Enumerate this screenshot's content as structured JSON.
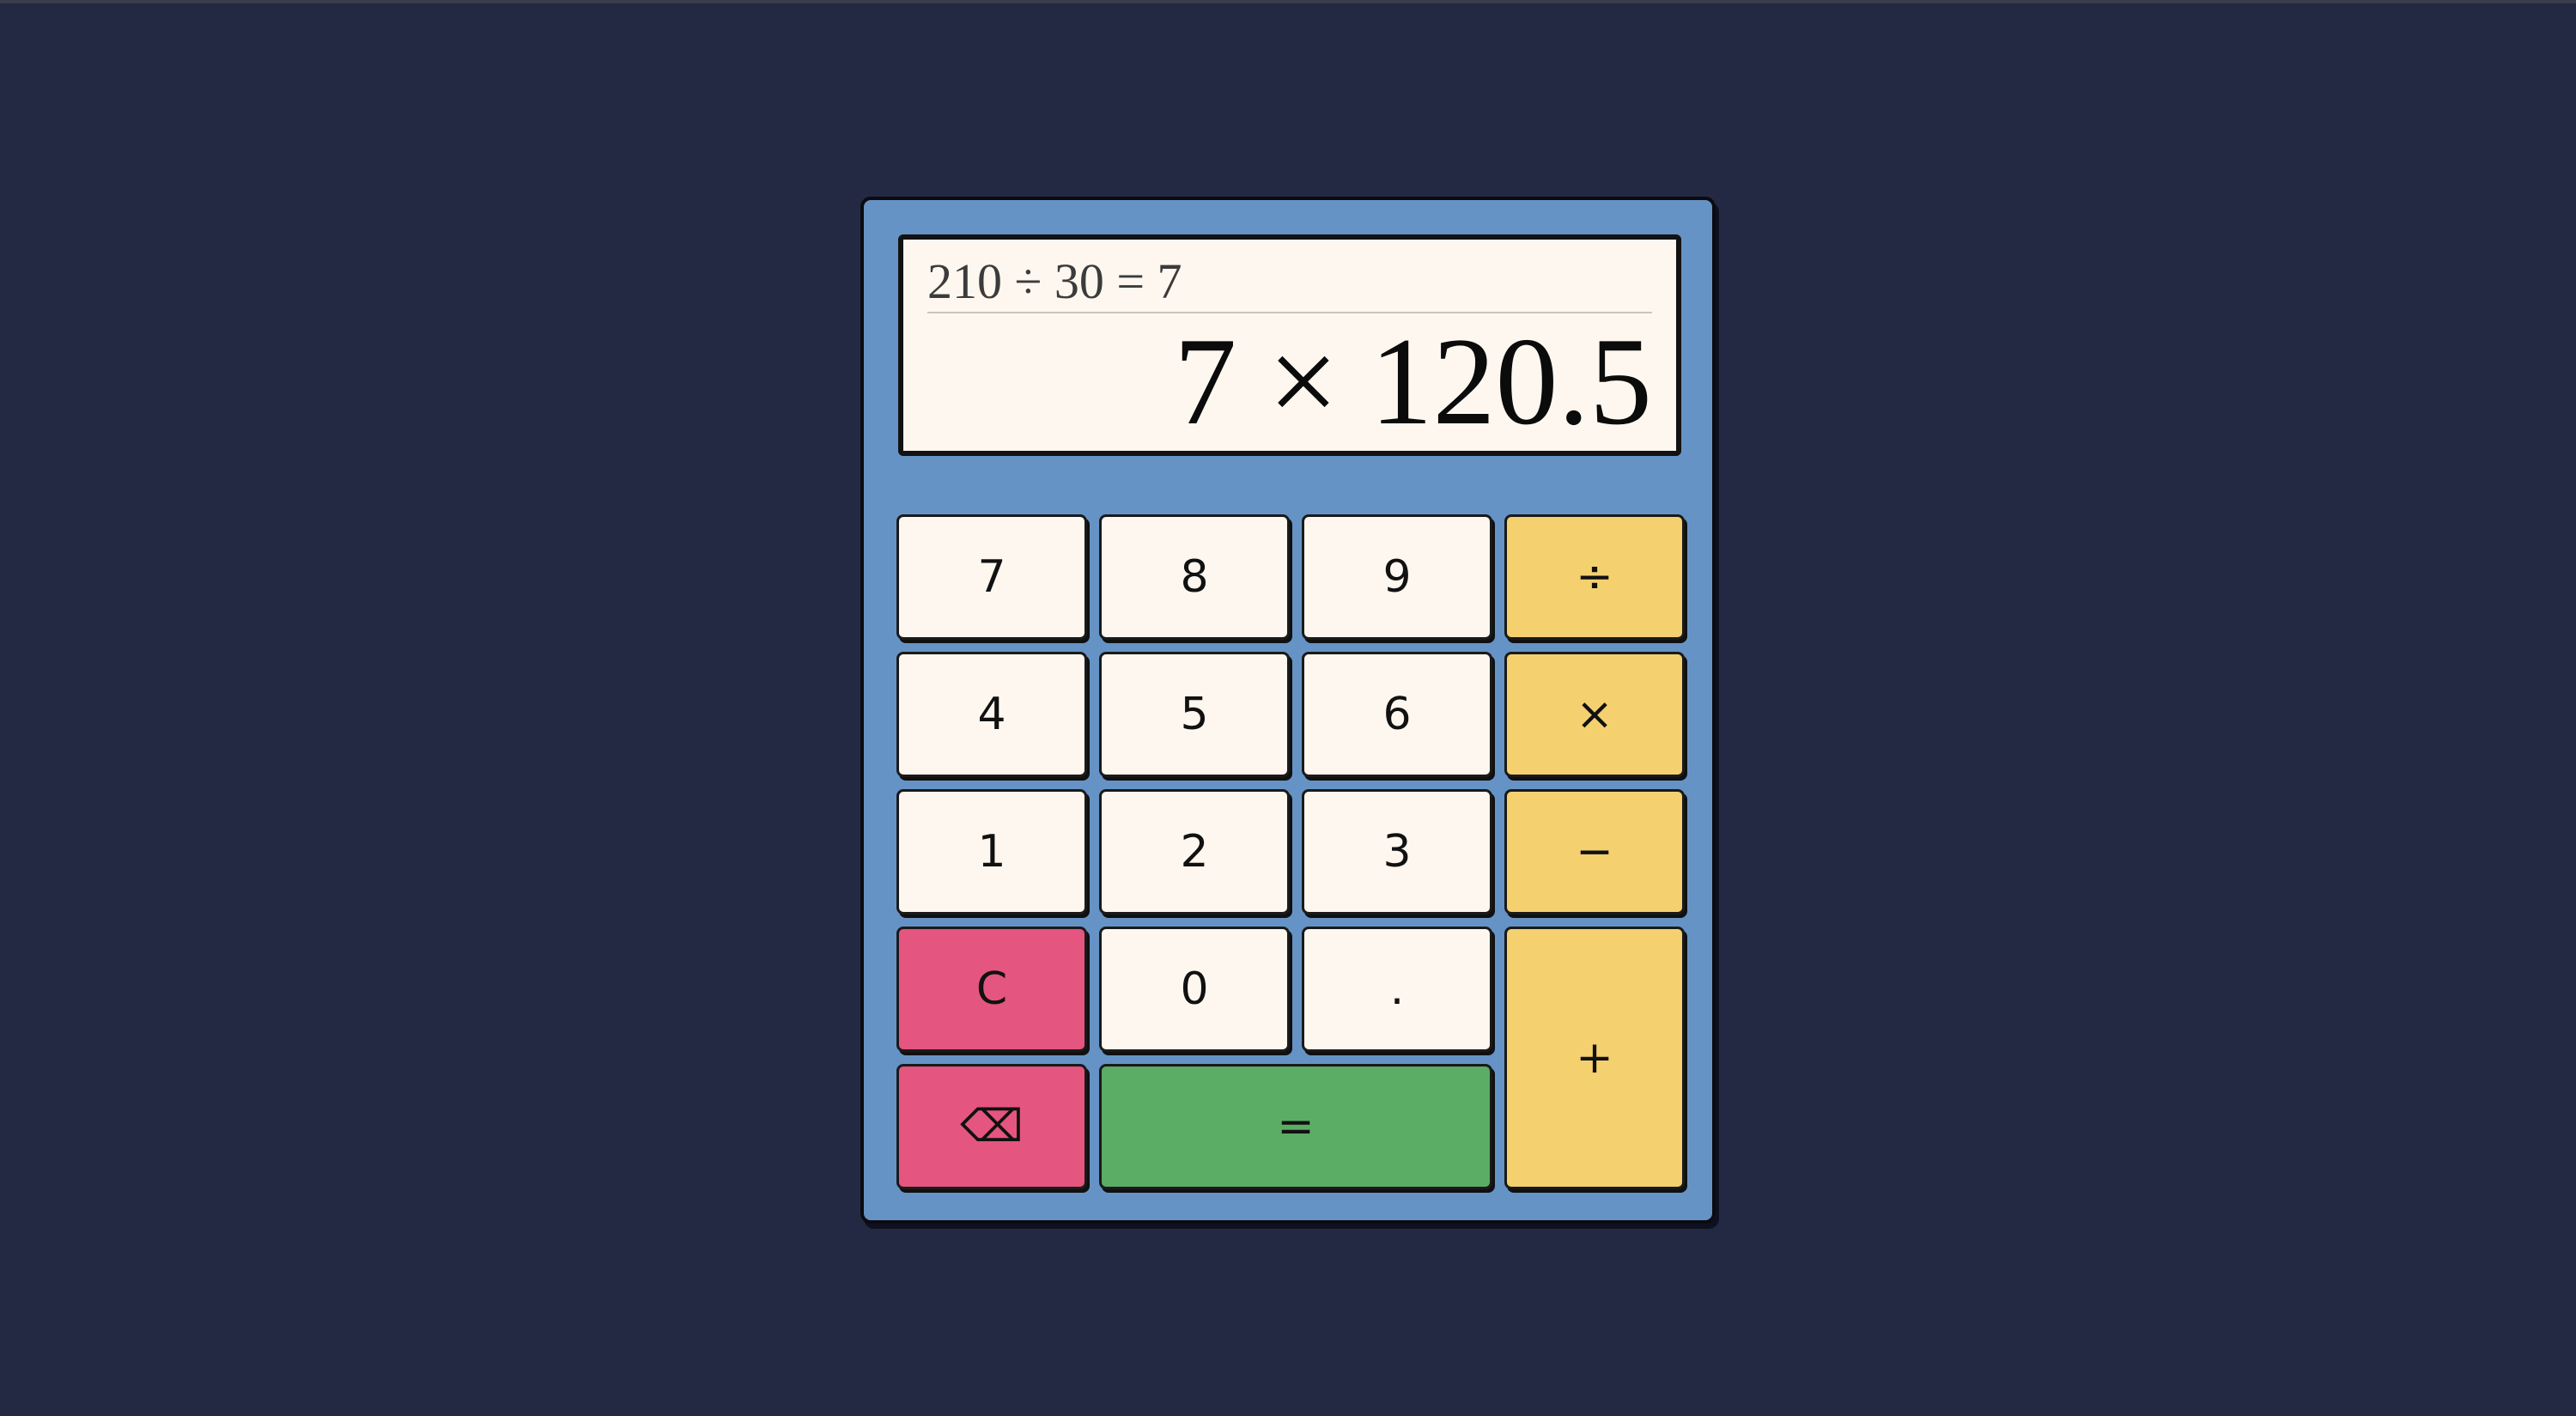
{
  "display": {
    "history": "210 ÷ 30 = 7",
    "current": "7 × 120.5"
  },
  "keys": {
    "k7": "7",
    "k8": "8",
    "k9": "9",
    "divide": "÷",
    "k4": "4",
    "k5": "5",
    "k6": "6",
    "multiply": "×",
    "k1": "1",
    "k2": "2",
    "k3": "3",
    "minus": "−",
    "clear": "C",
    "k0": "0",
    "decimal": ".",
    "plus": "+",
    "backspace": "⌫",
    "equals": "="
  },
  "colors": {
    "background": "#242943",
    "body": "#6693c6",
    "display": "#fdf7ef",
    "digit_key": "#fdf7ef",
    "operator_key": "#f4d06f",
    "clear_key": "#e4557f",
    "equals_key": "#5bad66"
  }
}
